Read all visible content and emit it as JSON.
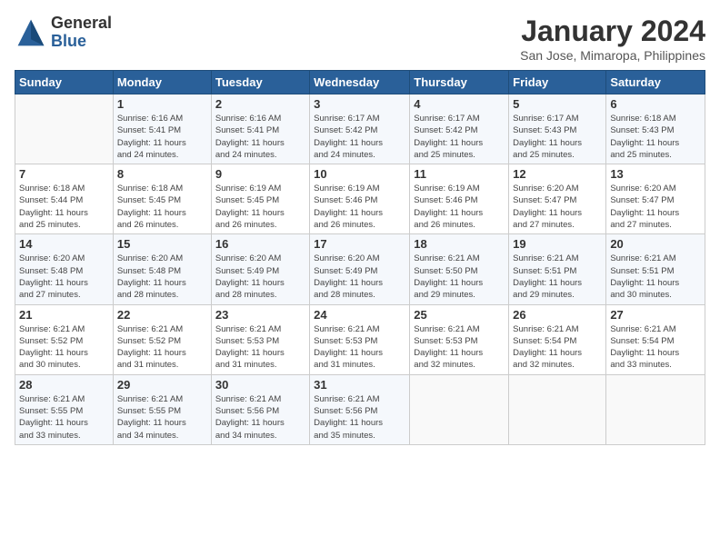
{
  "header": {
    "logo_general": "General",
    "logo_blue": "Blue",
    "month_title": "January 2024",
    "subtitle": "San Jose, Mimaropa, Philippines"
  },
  "days_of_week": [
    "Sunday",
    "Monday",
    "Tuesday",
    "Wednesday",
    "Thursday",
    "Friday",
    "Saturday"
  ],
  "weeks": [
    [
      {
        "day": "",
        "info": ""
      },
      {
        "day": "1",
        "info": "Sunrise: 6:16 AM\nSunset: 5:41 PM\nDaylight: 11 hours\nand 24 minutes."
      },
      {
        "day": "2",
        "info": "Sunrise: 6:16 AM\nSunset: 5:41 PM\nDaylight: 11 hours\nand 24 minutes."
      },
      {
        "day": "3",
        "info": "Sunrise: 6:17 AM\nSunset: 5:42 PM\nDaylight: 11 hours\nand 24 minutes."
      },
      {
        "day": "4",
        "info": "Sunrise: 6:17 AM\nSunset: 5:42 PM\nDaylight: 11 hours\nand 25 minutes."
      },
      {
        "day": "5",
        "info": "Sunrise: 6:17 AM\nSunset: 5:43 PM\nDaylight: 11 hours\nand 25 minutes."
      },
      {
        "day": "6",
        "info": "Sunrise: 6:18 AM\nSunset: 5:43 PM\nDaylight: 11 hours\nand 25 minutes."
      }
    ],
    [
      {
        "day": "7",
        "info": "Sunrise: 6:18 AM\nSunset: 5:44 PM\nDaylight: 11 hours\nand 25 minutes."
      },
      {
        "day": "8",
        "info": "Sunrise: 6:18 AM\nSunset: 5:45 PM\nDaylight: 11 hours\nand 26 minutes."
      },
      {
        "day": "9",
        "info": "Sunrise: 6:19 AM\nSunset: 5:45 PM\nDaylight: 11 hours\nand 26 minutes."
      },
      {
        "day": "10",
        "info": "Sunrise: 6:19 AM\nSunset: 5:46 PM\nDaylight: 11 hours\nand 26 minutes."
      },
      {
        "day": "11",
        "info": "Sunrise: 6:19 AM\nSunset: 5:46 PM\nDaylight: 11 hours\nand 26 minutes."
      },
      {
        "day": "12",
        "info": "Sunrise: 6:20 AM\nSunset: 5:47 PM\nDaylight: 11 hours\nand 27 minutes."
      },
      {
        "day": "13",
        "info": "Sunrise: 6:20 AM\nSunset: 5:47 PM\nDaylight: 11 hours\nand 27 minutes."
      }
    ],
    [
      {
        "day": "14",
        "info": "Sunrise: 6:20 AM\nSunset: 5:48 PM\nDaylight: 11 hours\nand 27 minutes."
      },
      {
        "day": "15",
        "info": "Sunrise: 6:20 AM\nSunset: 5:48 PM\nDaylight: 11 hours\nand 28 minutes."
      },
      {
        "day": "16",
        "info": "Sunrise: 6:20 AM\nSunset: 5:49 PM\nDaylight: 11 hours\nand 28 minutes."
      },
      {
        "day": "17",
        "info": "Sunrise: 6:20 AM\nSunset: 5:49 PM\nDaylight: 11 hours\nand 28 minutes."
      },
      {
        "day": "18",
        "info": "Sunrise: 6:21 AM\nSunset: 5:50 PM\nDaylight: 11 hours\nand 29 minutes."
      },
      {
        "day": "19",
        "info": "Sunrise: 6:21 AM\nSunset: 5:51 PM\nDaylight: 11 hours\nand 29 minutes."
      },
      {
        "day": "20",
        "info": "Sunrise: 6:21 AM\nSunset: 5:51 PM\nDaylight: 11 hours\nand 30 minutes."
      }
    ],
    [
      {
        "day": "21",
        "info": "Sunrise: 6:21 AM\nSunset: 5:52 PM\nDaylight: 11 hours\nand 30 minutes."
      },
      {
        "day": "22",
        "info": "Sunrise: 6:21 AM\nSunset: 5:52 PM\nDaylight: 11 hours\nand 31 minutes."
      },
      {
        "day": "23",
        "info": "Sunrise: 6:21 AM\nSunset: 5:53 PM\nDaylight: 11 hours\nand 31 minutes."
      },
      {
        "day": "24",
        "info": "Sunrise: 6:21 AM\nSunset: 5:53 PM\nDaylight: 11 hours\nand 31 minutes."
      },
      {
        "day": "25",
        "info": "Sunrise: 6:21 AM\nSunset: 5:53 PM\nDaylight: 11 hours\nand 32 minutes."
      },
      {
        "day": "26",
        "info": "Sunrise: 6:21 AM\nSunset: 5:54 PM\nDaylight: 11 hours\nand 32 minutes."
      },
      {
        "day": "27",
        "info": "Sunrise: 6:21 AM\nSunset: 5:54 PM\nDaylight: 11 hours\nand 33 minutes."
      }
    ],
    [
      {
        "day": "28",
        "info": "Sunrise: 6:21 AM\nSunset: 5:55 PM\nDaylight: 11 hours\nand 33 minutes."
      },
      {
        "day": "29",
        "info": "Sunrise: 6:21 AM\nSunset: 5:55 PM\nDaylight: 11 hours\nand 34 minutes."
      },
      {
        "day": "30",
        "info": "Sunrise: 6:21 AM\nSunset: 5:56 PM\nDaylight: 11 hours\nand 34 minutes."
      },
      {
        "day": "31",
        "info": "Sunrise: 6:21 AM\nSunset: 5:56 PM\nDaylight: 11 hours\nand 35 minutes."
      },
      {
        "day": "",
        "info": ""
      },
      {
        "day": "",
        "info": ""
      },
      {
        "day": "",
        "info": ""
      }
    ]
  ]
}
